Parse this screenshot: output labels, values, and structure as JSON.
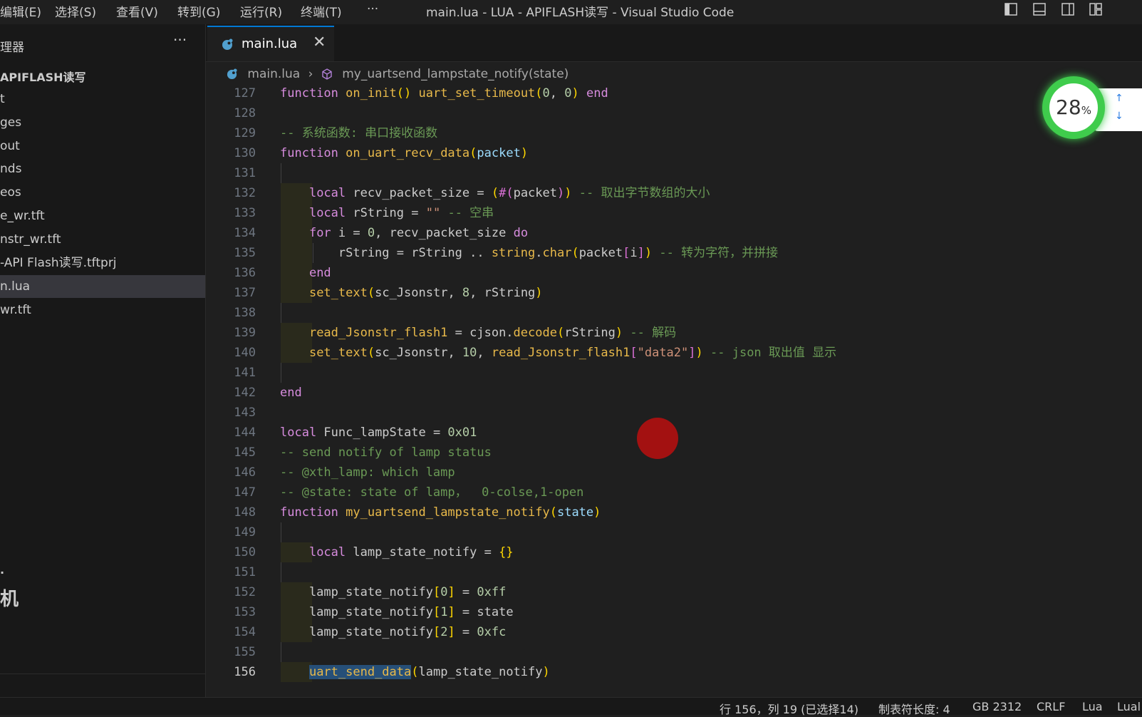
{
  "menu": {
    "edit": "编辑(E)",
    "select": "选择(S)",
    "view": "查看(V)",
    "goto": "转到(G)",
    "run": "运行(R)",
    "terminal": "终端(T)",
    "more": "···"
  },
  "window_title": "main.lua - LUA - APIFLASH读写 - Visual Studio Code",
  "sidebar": {
    "title": "理器",
    "more": "···",
    "folder": "APIFLASH读写",
    "items": [
      {
        "label": "t"
      },
      {
        "label": "ges"
      },
      {
        "label": "out"
      },
      {
        "label": "nds"
      },
      {
        "label": "eos"
      },
      {
        "label": "e_wr.tft"
      },
      {
        "label": "nstr_wr.tft"
      },
      {
        "label": "-API Flash读写.tftprj"
      },
      {
        "label": "n.lua"
      },
      {
        "label": "wr.tft"
      }
    ],
    "glyph_small": "∙",
    "glyph_big": "机"
  },
  "tab": {
    "label": "main.lua",
    "close": "✕"
  },
  "breadcrumb": {
    "file": "main.lua",
    "sep": "›",
    "symbol": "my_uartsend_lampstate_notify(state)"
  },
  "line_numbers": [
    "127",
    "128",
    "129",
    "130",
    "131",
    "132",
    "133",
    "134",
    "135",
    "136",
    "137",
    "138",
    "139",
    "140",
    "141",
    "142",
    "143",
    "144",
    "145",
    "146",
    "147",
    "148",
    "149",
    "150",
    "151",
    "152",
    "153",
    "154",
    "155",
    "156"
  ],
  "current_line": "156",
  "widget": {
    "value": "28",
    "unit": "%",
    "up": "↑",
    "down": "↓"
  },
  "status": {
    "position": "行 156，列 19 (已选择14)",
    "tab_size": "制表符长度: 4",
    "encoding": "GB 2312",
    "eol": "CRLF",
    "language": "Lua",
    "extra": "Lual"
  },
  "colors": {
    "accent": "#0078d4",
    "widget_ring": "#3fcc4c",
    "cursor_dot": "#a31111"
  }
}
